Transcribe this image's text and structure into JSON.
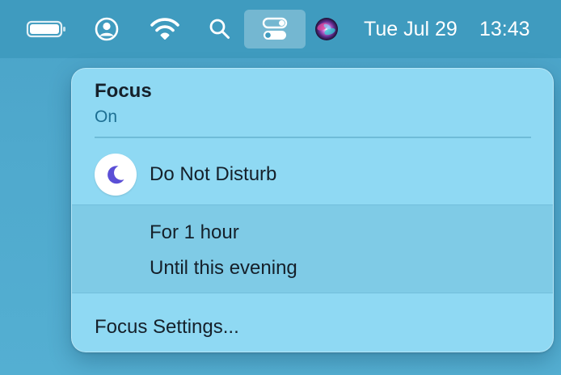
{
  "menubar": {
    "icons": [
      "battery-icon",
      "user-account-icon",
      "wifi-icon",
      "search-icon",
      "control-center-icon",
      "siri-icon"
    ],
    "clock_date": "Tue Jul 29",
    "clock_time": "13:43"
  },
  "focus_panel": {
    "title": "Focus",
    "status": "On",
    "mode": {
      "label": "Do Not Disturb",
      "icon": "moon-icon",
      "icon_color": "#5b4fd6"
    },
    "options": [
      "For 1 hour",
      "Until this evening"
    ],
    "settings_label": "Focus Settings..."
  },
  "colors": {
    "menubar": "#3f9bbf",
    "panel": "#8fd9f3",
    "options_bg": "#7fcbe6",
    "status_text": "#1d6f93"
  }
}
